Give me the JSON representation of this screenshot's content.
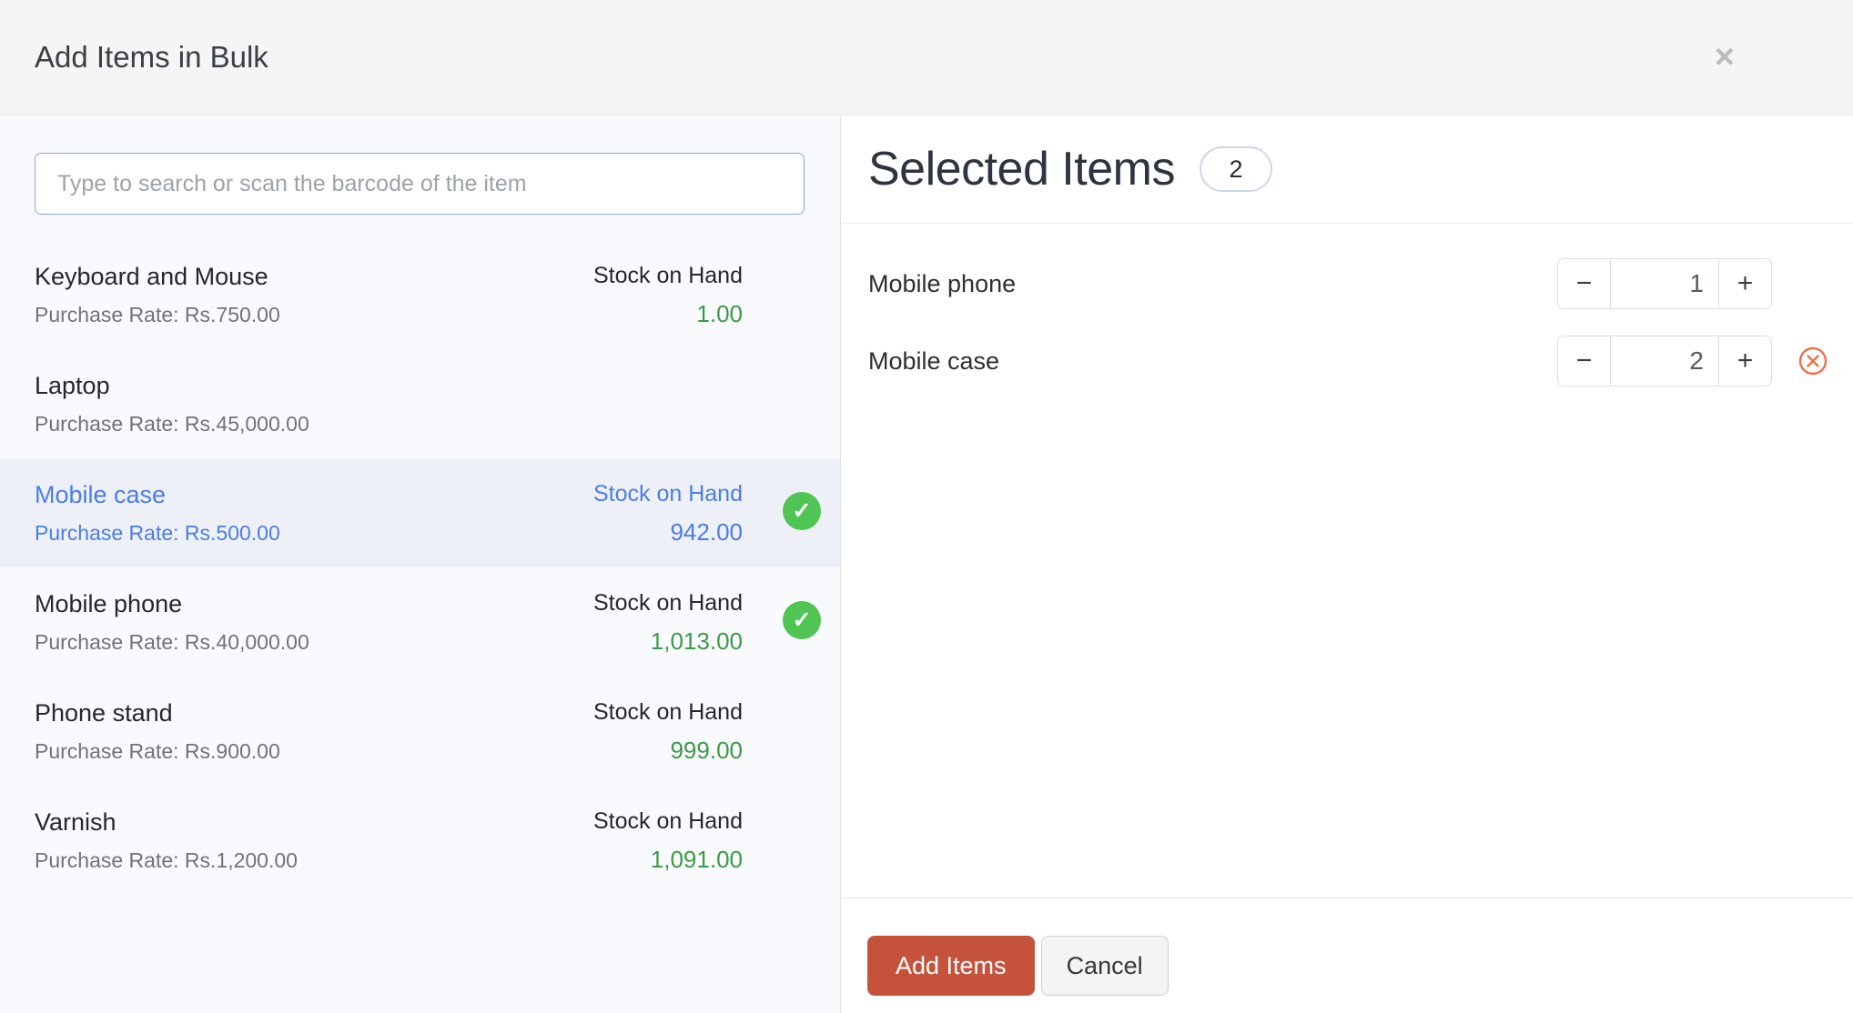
{
  "modal": {
    "title": "Add Items in Bulk"
  },
  "icons": {
    "close_glyph": "×",
    "check_glyph": "✓"
  },
  "search": {
    "placeholder": "Type to search or scan the barcode of the item"
  },
  "item_list": [
    {
      "name": "Keyboard and Mouse",
      "purchase_rate": "Purchase Rate: Rs.750.00",
      "stock_label": "Stock on Hand",
      "stock_value": "1.00",
      "selected": false,
      "highlighted": false
    },
    {
      "name": "Laptop",
      "purchase_rate": "Purchase Rate: Rs.45,000.00",
      "stock_label": "",
      "stock_value": "",
      "selected": false,
      "highlighted": false
    },
    {
      "name": "Mobile case",
      "purchase_rate": "Purchase Rate: Rs.500.00",
      "stock_label": "Stock on Hand",
      "stock_value": "942.00",
      "selected": true,
      "highlighted": true
    },
    {
      "name": "Mobile phone",
      "purchase_rate": "Purchase Rate: Rs.40,000.00",
      "stock_label": "Stock on Hand",
      "stock_value": "1,013.00",
      "selected": true,
      "highlighted": false
    },
    {
      "name": "Phone stand",
      "purchase_rate": "Purchase Rate: Rs.900.00",
      "stock_label": "Stock on Hand",
      "stock_value": "999.00",
      "selected": false,
      "highlighted": false
    },
    {
      "name": "Varnish",
      "purchase_rate": "Purchase Rate: Rs.1,200.00",
      "stock_label": "Stock on Hand",
      "stock_value": "1,091.00",
      "selected": false,
      "highlighted": false
    }
  ],
  "selected_panel": {
    "title": "Selected Items",
    "count": "2",
    "items": [
      {
        "name": "Mobile phone",
        "quantity": "1",
        "removable": false
      },
      {
        "name": "Mobile case",
        "quantity": "2",
        "removable": true
      }
    ],
    "add_button": "Add Items",
    "cancel_button": "Cancel"
  },
  "stepper": {
    "minus_label": "−",
    "plus_label": "+"
  },
  "colors": {
    "accent_red": "#c5533c",
    "link_blue": "#4c7ce8",
    "success_green": "#50c554",
    "stock_green": "#3d9a47",
    "remove_orange": "#ed7049",
    "search_border_blue": "#87a4ea"
  }
}
